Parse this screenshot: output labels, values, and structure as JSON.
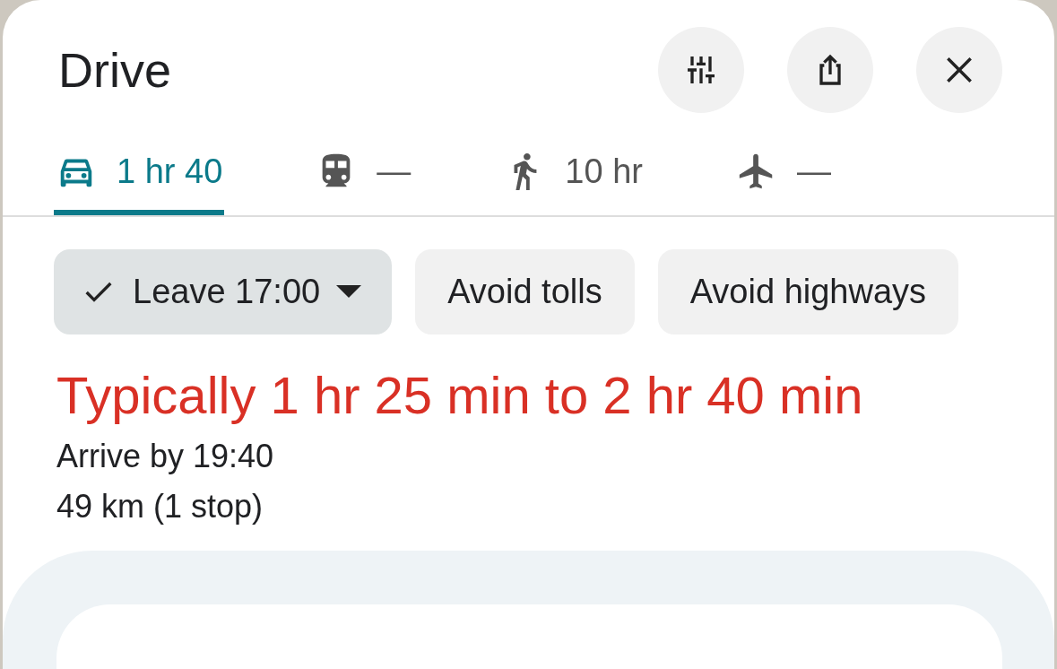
{
  "title": "Drive",
  "tabs": [
    {
      "kind": "car",
      "label": "1 hr 40",
      "selected": true
    },
    {
      "kind": "train",
      "label": "—",
      "selected": false
    },
    {
      "kind": "walk",
      "label": "10 hr",
      "selected": false
    },
    {
      "kind": "plane",
      "label": "—",
      "selected": false
    }
  ],
  "chips": [
    {
      "label": "Leave 17:00",
      "selected": true,
      "dropdown": true
    },
    {
      "label": "Avoid tolls",
      "selected": false,
      "dropdown": false
    },
    {
      "label": "Avoid highways",
      "selected": false,
      "dropdown": false
    }
  ],
  "typical": "Typically 1 hr 25 min to 2 hr 40 min",
  "arrive": "Arrive by 19:40",
  "distance": "49 km (1 stop)"
}
